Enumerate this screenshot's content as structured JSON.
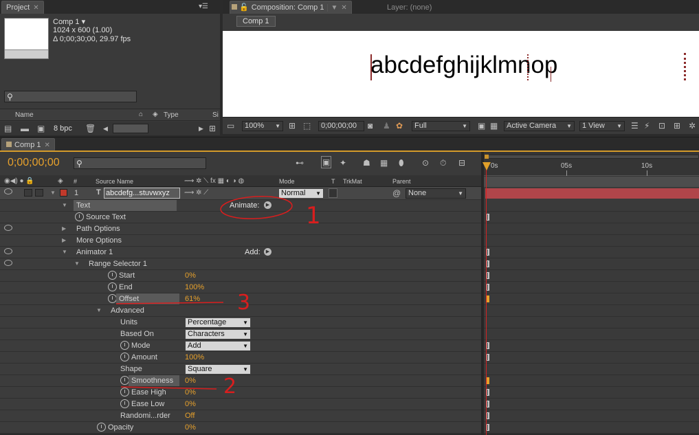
{
  "project": {
    "tab": "Project",
    "comp_name": "Comp 1 ▾",
    "comp_size": "1024 x 600 (1.00)",
    "comp_duration": "Δ 0;00;30;00, 29.97 fps",
    "col_name": "Name",
    "col_type": "Type",
    "col_size": "Si",
    "bpc": "8 bpc"
  },
  "viewer": {
    "tab": "Composition: Comp 1",
    "layer_tab": "Layer: (none)",
    "breadcrumb": "Comp 1",
    "canvas_text": "abcdefghijklmnop",
    "zoom": "100%",
    "timecode": "0;00;00;00",
    "resolution": "Full",
    "camera": "Active Camera",
    "views": "1 View"
  },
  "timeline": {
    "tab": "Comp 1",
    "current_time": "0;00;00;00",
    "col_num": "#",
    "col_source": "Source Name",
    "col_mode": "Mode",
    "col_t": "T",
    "col_trkmat": "TrkMat",
    "col_parent": "Parent",
    "layer_index": "1",
    "layer_name": "abcdefg...stuvwxyz",
    "layer_mode": "Normal",
    "layer_parent": "None",
    "animate_label": "Animate:",
    "add_label": "Add:",
    "ruler": [
      "0s",
      "05s",
      "10s"
    ],
    "rows": [
      {
        "label": "Text"
      },
      {
        "label": "Source Text"
      },
      {
        "label": "Path Options"
      },
      {
        "label": "More Options"
      },
      {
        "label": "Animator 1"
      },
      {
        "label": "Range Selector 1"
      },
      {
        "label": "Start",
        "value": "0%"
      },
      {
        "label": "End",
        "value": "100%"
      },
      {
        "label": "Offset",
        "value": "61%"
      },
      {
        "label": "Advanced"
      },
      {
        "label": "Units",
        "value": "Percentage"
      },
      {
        "label": "Based On",
        "value": "Characters"
      },
      {
        "label": "Mode",
        "value": "Add"
      },
      {
        "label": "Amount",
        "value": "100%"
      },
      {
        "label": "Shape",
        "value": "Square"
      },
      {
        "label": "Smoothness",
        "value": "0%"
      },
      {
        "label": "Ease High",
        "value": "0%"
      },
      {
        "label": "Ease Low",
        "value": "0%"
      },
      {
        "label": "Randomi...rder",
        "value": "Off"
      },
      {
        "label": "Opacity",
        "value": "0%"
      }
    ],
    "annotations": [
      "1",
      "3",
      "2"
    ]
  },
  "colors": {
    "accent": "#e7a12c",
    "layer_bar": "#b0454a",
    "annotation": "#d81e1e",
    "label_red": "#c0392b"
  }
}
